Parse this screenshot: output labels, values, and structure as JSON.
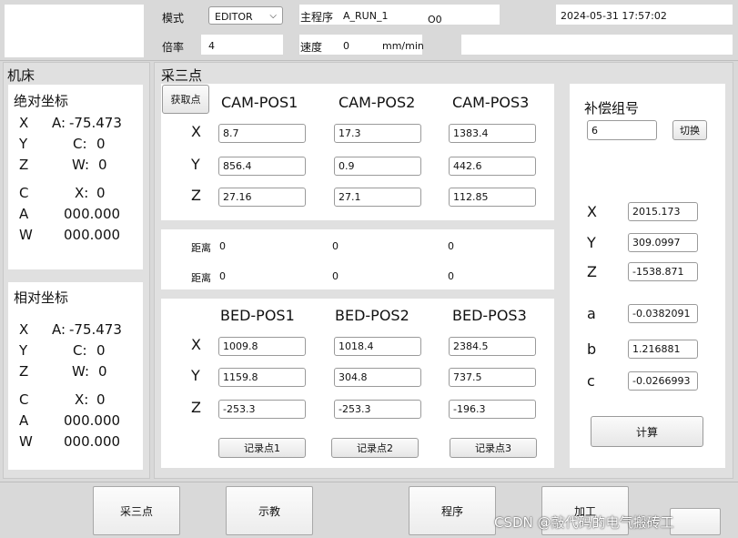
{
  "header": {
    "mode_label": "模式",
    "mode_value": "EDITOR",
    "main_program_label": "主程序",
    "main_program_value": "A_RUN_1",
    "o_value": "O0",
    "datetime": "2024-05-31 17:57:02",
    "rate_label": "倍率",
    "rate_value": "4",
    "speed_label": "速度",
    "speed_value": "0",
    "speed_unit": "mm/min"
  },
  "machine": {
    "title": "机床",
    "absolute": {
      "title": "绝对坐标",
      "rows": [
        {
          "axis": "X",
          "label": "A:",
          "value": "-75.473"
        },
        {
          "axis": "Y",
          "label": "C:",
          "value": "0"
        },
        {
          "axis": "Z",
          "label": "W:",
          "value": "0"
        },
        {
          "axis": "C",
          "label": "X:",
          "value": "0"
        },
        {
          "axis": "A",
          "label": "",
          "value": "000.000"
        },
        {
          "axis": "W",
          "label": "",
          "value": "000.000"
        }
      ]
    },
    "relative": {
      "title": "相对坐标",
      "rows": [
        {
          "axis": "X",
          "label": "A:",
          "value": "-75.473"
        },
        {
          "axis": "Y",
          "label": "C:",
          "value": "0"
        },
        {
          "axis": "Z",
          "label": "W:",
          "value": "0"
        },
        {
          "axis": "C",
          "label": "X:",
          "value": "0"
        },
        {
          "axis": "A",
          "label": "",
          "value": "000.000"
        },
        {
          "axis": "W",
          "label": "",
          "value": "000.000"
        }
      ]
    }
  },
  "three_point": {
    "title": "采三点",
    "get_point_label": "获取点",
    "cam_headers": [
      "CAM-POS1",
      "CAM-POS2",
      "CAM-POS3"
    ],
    "axis_labels": [
      "X",
      "Y",
      "Z"
    ],
    "cam_values": [
      [
        "8.7",
        "17.3",
        "1383.4"
      ],
      [
        "856.4",
        "0.9",
        "442.6"
      ],
      [
        "27.16",
        "27.1",
        "112.85"
      ]
    ],
    "distance_label": "距离",
    "distance_rows": [
      [
        "0",
        "0",
        "0"
      ],
      [
        "0",
        "0",
        "0"
      ]
    ],
    "bed_headers": [
      "BED-POS1",
      "BED-POS2",
      "BED-POS3"
    ],
    "bed_values": [
      [
        "1009.8",
        "1018.4",
        "2384.5"
      ],
      [
        "1159.8",
        "304.8",
        "737.5"
      ],
      [
        "-253.3",
        "-253.3",
        "-196.3"
      ]
    ],
    "record_labels": [
      "记录点1",
      "记录点2",
      "记录点3"
    ]
  },
  "compensation": {
    "title": "补偿组号",
    "group_value": "6",
    "switch_label": "切换",
    "rows": [
      {
        "label": "X",
        "value": "2015.173"
      },
      {
        "label": "Y",
        "value": "309.0997"
      },
      {
        "label": "Z",
        "value": "-1538.871"
      },
      {
        "label": "a",
        "value": "-0.0382091"
      },
      {
        "label": "b",
        "value": "1.216881"
      },
      {
        "label": "c",
        "value": "-0.0266993"
      }
    ],
    "calc_label": "计算"
  },
  "footer": {
    "buttons": [
      "采三点",
      "示教",
      "程序",
      "加工"
    ],
    "watermark": "CSDN @敲代码的电气搬砖工"
  }
}
